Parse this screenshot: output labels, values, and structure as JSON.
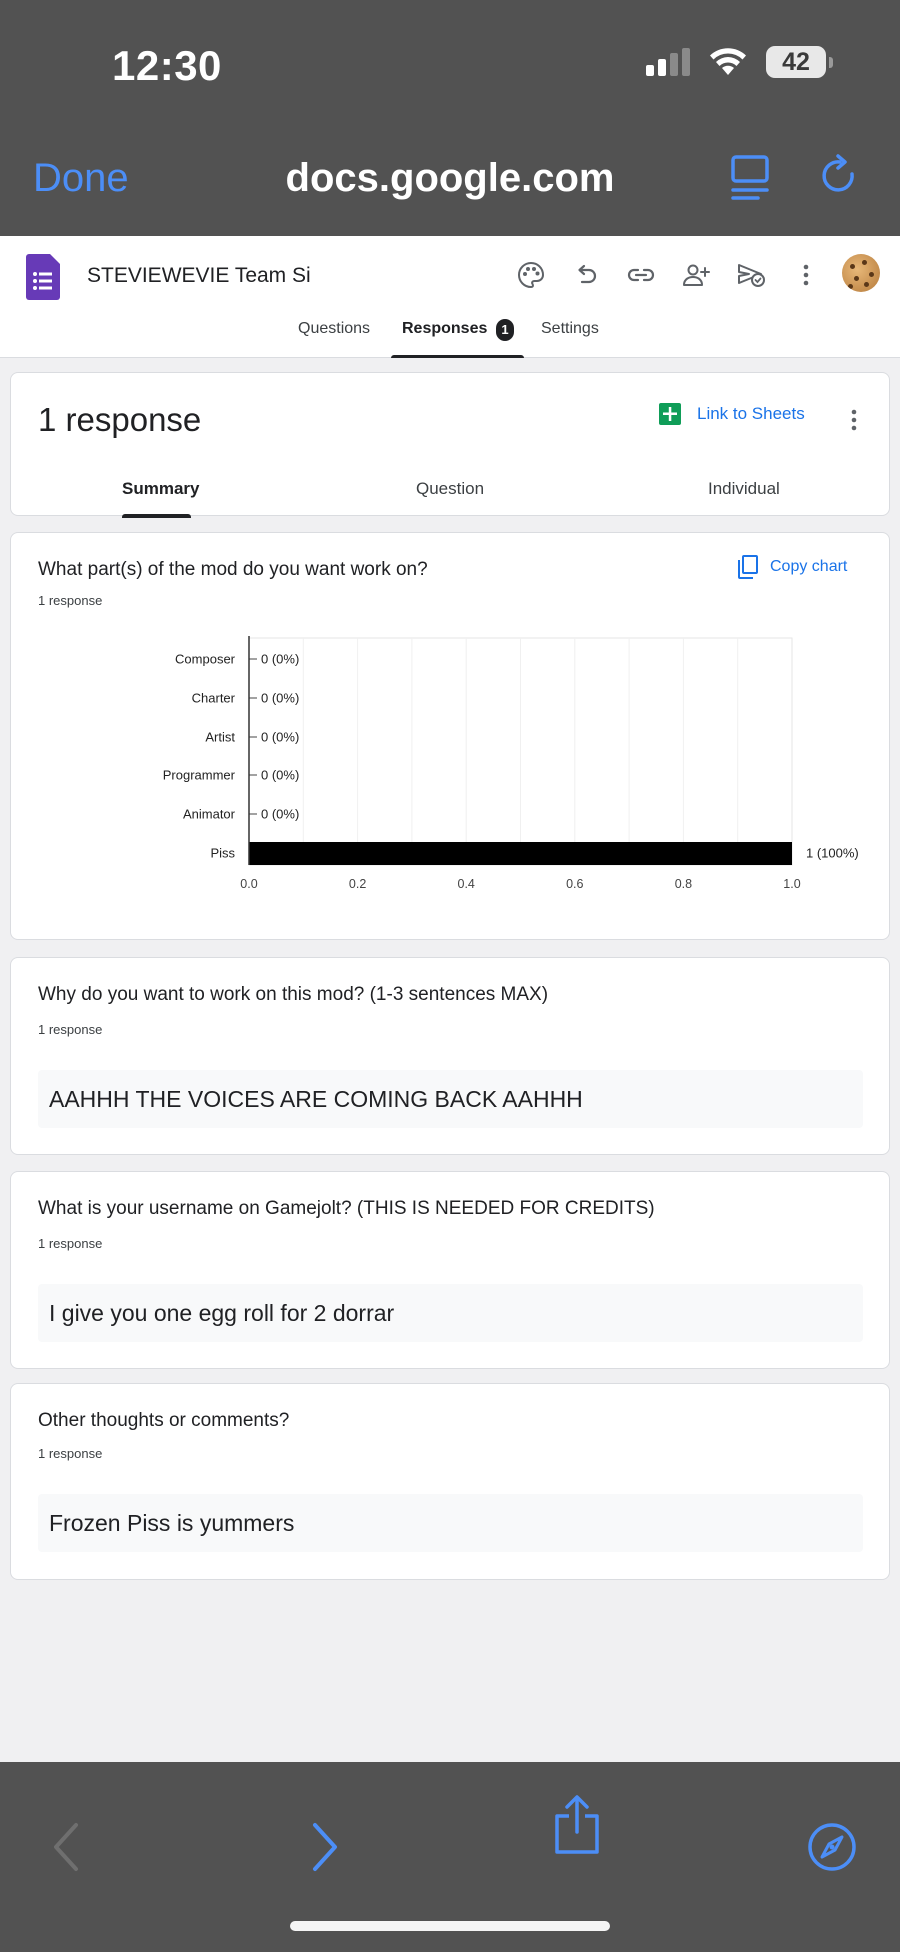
{
  "status_bar": {
    "time": "12:30",
    "battery": "42"
  },
  "browser": {
    "done_label": "Done",
    "url": "docs.google.com"
  },
  "form_header": {
    "title": "STEVIEWEVIE Team Si",
    "tabs": [
      {
        "label": "Questions"
      },
      {
        "label": "Responses",
        "badge": "1"
      },
      {
        "label": "Settings"
      }
    ]
  },
  "summary_card": {
    "response_count": "1 response",
    "link_to_sheets": "Link to Sheets",
    "subtabs": [
      "Summary",
      "Question",
      "Individual"
    ]
  },
  "questions": [
    {
      "title": "What part(s) of the mod do you want work on?",
      "count": "1 response",
      "copy_chart": "Copy chart"
    },
    {
      "title": "Why do you want to work on this mod? (1-3 sentences MAX)",
      "count": "1 response",
      "answer": "AAHHH THE VOICES ARE COMING BACK AAHHH"
    },
    {
      "title": "What is your username on Gamejolt? (THIS IS NEEDED FOR CREDITS)",
      "count": "1 response",
      "answer": "I give you one egg roll for 2 dorrar"
    },
    {
      "title": "Other thoughts or comments?",
      "count": "1 response",
      "answer": "Frozen Piss is yummers"
    }
  ],
  "chart_data": {
    "type": "bar",
    "orientation": "horizontal",
    "categories": [
      "Composer",
      "Charter",
      "Artist",
      "Programmer",
      "Animator",
      "Piss"
    ],
    "values": [
      0,
      0,
      0,
      0,
      0,
      1
    ],
    "value_labels": [
      "0 (0%)",
      "0 (0%)",
      "0 (0%)",
      "0 (0%)",
      "0 (0%)",
      "1 (100%)"
    ],
    "xlim": [
      0,
      1
    ],
    "x_ticks": [
      "0.0",
      "0.2",
      "0.4",
      "0.6",
      "0.8",
      "1.0"
    ],
    "bar_color": "#000000",
    "grid": true
  },
  "colors": {
    "accent": "#1a73e8",
    "forms_purple": "#673ab7",
    "sheets_green": "#0f9d58",
    "ios_blue": "#4c8ef7"
  }
}
